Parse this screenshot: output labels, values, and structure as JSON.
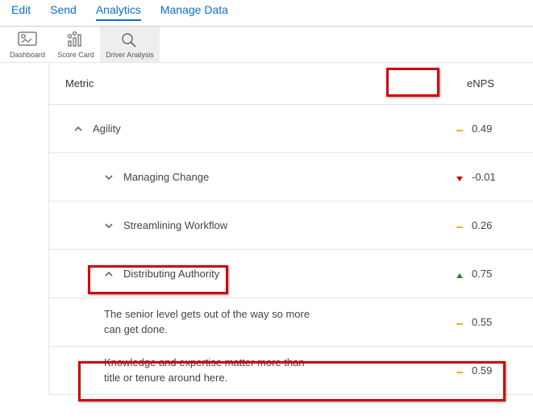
{
  "nav": {
    "tabs": [
      "Edit",
      "Send",
      "Analytics",
      "Manage Data"
    ],
    "activeTab": "Analytics"
  },
  "toolbar": {
    "items": [
      {
        "label": "Dashboard"
      },
      {
        "label": "Score Card"
      },
      {
        "label": "Driver Analysis"
      }
    ],
    "active": "Driver Analysis"
  },
  "table": {
    "metricHeader": "Metric",
    "valueHeader": "eNPS",
    "rows": [
      {
        "indent": 0,
        "expand": "up",
        "label": "Agility",
        "trend": "flat",
        "value": "0.49"
      },
      {
        "indent": 1,
        "expand": "down",
        "label": "Managing Change",
        "trend": "down",
        "value": "-0.01"
      },
      {
        "indent": 1,
        "expand": "down",
        "label": "Streamlining Workflow",
        "trend": "flat",
        "value": "0.26"
      },
      {
        "indent": 1,
        "expand": "up",
        "label": "Distributing Authority",
        "trend": "up",
        "value": "0.75"
      },
      {
        "indent": 2,
        "expand": "none",
        "label": "The senior level gets out of the way so more can get done.",
        "trend": "flat",
        "value": "0.55"
      },
      {
        "indent": 2,
        "expand": "none",
        "label": "Knowledge and expertise matter more than title or tenure around here.",
        "trend": "flat",
        "value": "0.59"
      }
    ]
  }
}
